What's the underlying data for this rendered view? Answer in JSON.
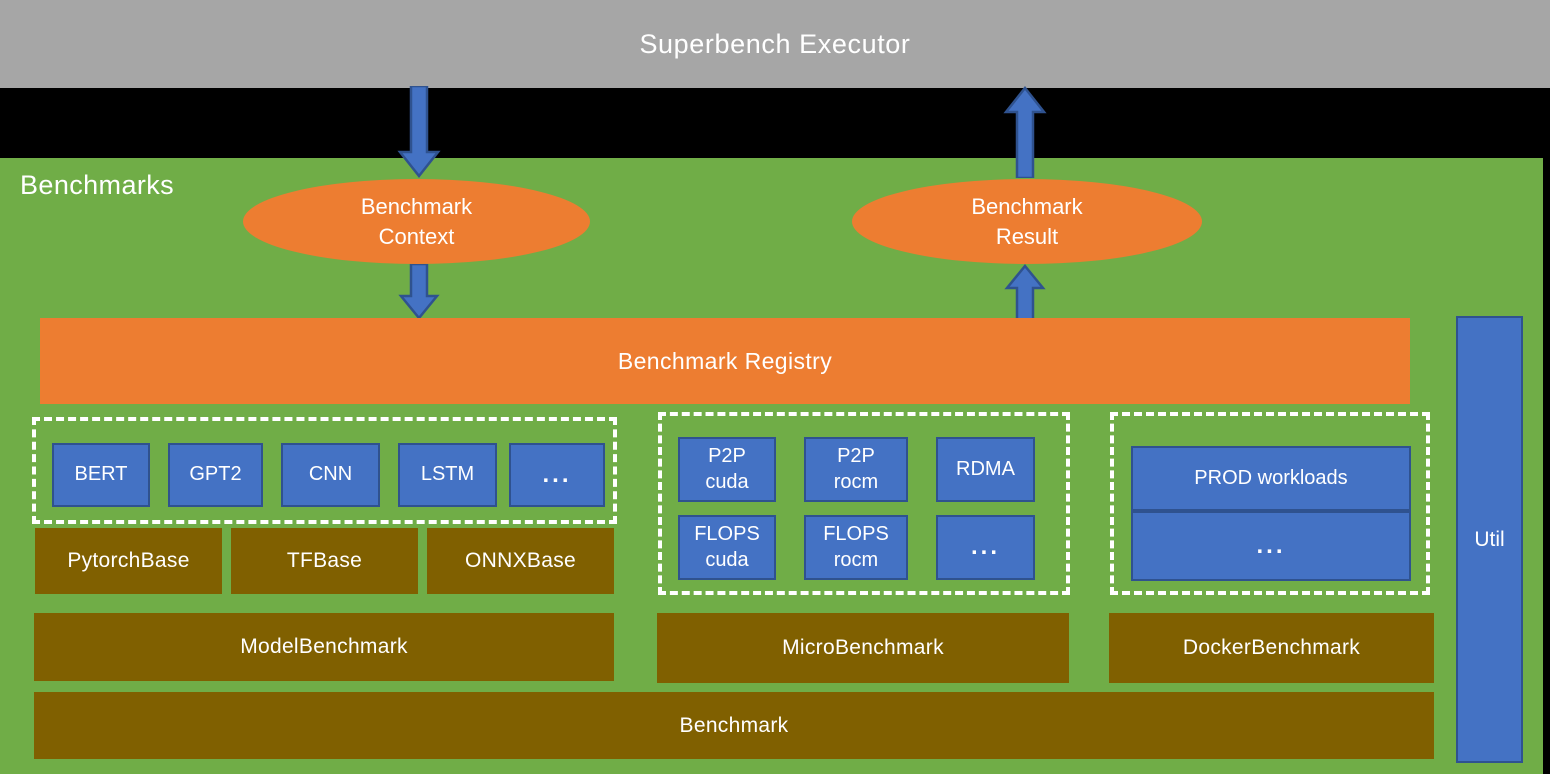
{
  "executor": {
    "title": "Superbench Executor",
    "bg_color": "#a6a6a6"
  },
  "benchmarks_panel": {
    "label": "Benchmarks",
    "bg_color": "#70ad47"
  },
  "ellipses": [
    {
      "id": "benchmark-context",
      "line1": "Benchmark",
      "line2": "Context",
      "color": "#ed7d31"
    },
    {
      "id": "benchmark-result",
      "line1": "Benchmark",
      "line2": "Result",
      "color": "#ed7d31"
    }
  ],
  "registry": {
    "label": "Benchmark Registry",
    "color": "#ed7d31"
  },
  "arrows": [
    {
      "id": "executor-to-context",
      "direction": "down",
      "color": "#4472c4"
    },
    {
      "id": "result-to-executor",
      "direction": "up",
      "color": "#4472c4"
    },
    {
      "id": "context-to-registry",
      "direction": "down",
      "color": "#4472c4"
    },
    {
      "id": "registry-to-result",
      "direction": "up",
      "color": "#4472c4"
    }
  ],
  "groups": {
    "models": {
      "blocks": [
        {
          "line1": "BERT",
          "line2": ""
        },
        {
          "line1": "GPT2",
          "line2": ""
        },
        {
          "line1": "CNN",
          "line2": ""
        },
        {
          "line1": "LSTM",
          "line2": ""
        },
        {
          "line1": "...",
          "line2": ""
        }
      ],
      "bases": [
        "PytorchBase",
        "TFBase",
        "ONNXBase"
      ],
      "parent": "ModelBenchmark"
    },
    "micro": {
      "blocks": [
        {
          "line1": "P2P",
          "line2": "cuda"
        },
        {
          "line1": "P2P",
          "line2": "rocm"
        },
        {
          "line1": "RDMA",
          "line2": ""
        },
        {
          "line1": "FLOPS",
          "line2": "cuda"
        },
        {
          "line1": "FLOPS",
          "line2": "rocm"
        },
        {
          "line1": "...",
          "line2": ""
        }
      ],
      "parent": "MicroBenchmark"
    },
    "docker": {
      "blocks": [
        {
          "line1": "PROD workloads",
          "line2": ""
        },
        {
          "line1": "...",
          "line2": ""
        }
      ],
      "parent": "DockerBenchmark"
    }
  },
  "base_class": {
    "label": "Benchmark"
  },
  "util": {
    "label": "Util",
    "color": "#4472c4"
  },
  "colors": {
    "green_panel": "#70ad47",
    "orange": "#ed7d31",
    "blue": "#4472c4",
    "blue_border": "#2f528f",
    "brown": "#806000",
    "gray_header": "#a6a6a6",
    "black_bg": "#000000",
    "white": "#ffffff"
  }
}
